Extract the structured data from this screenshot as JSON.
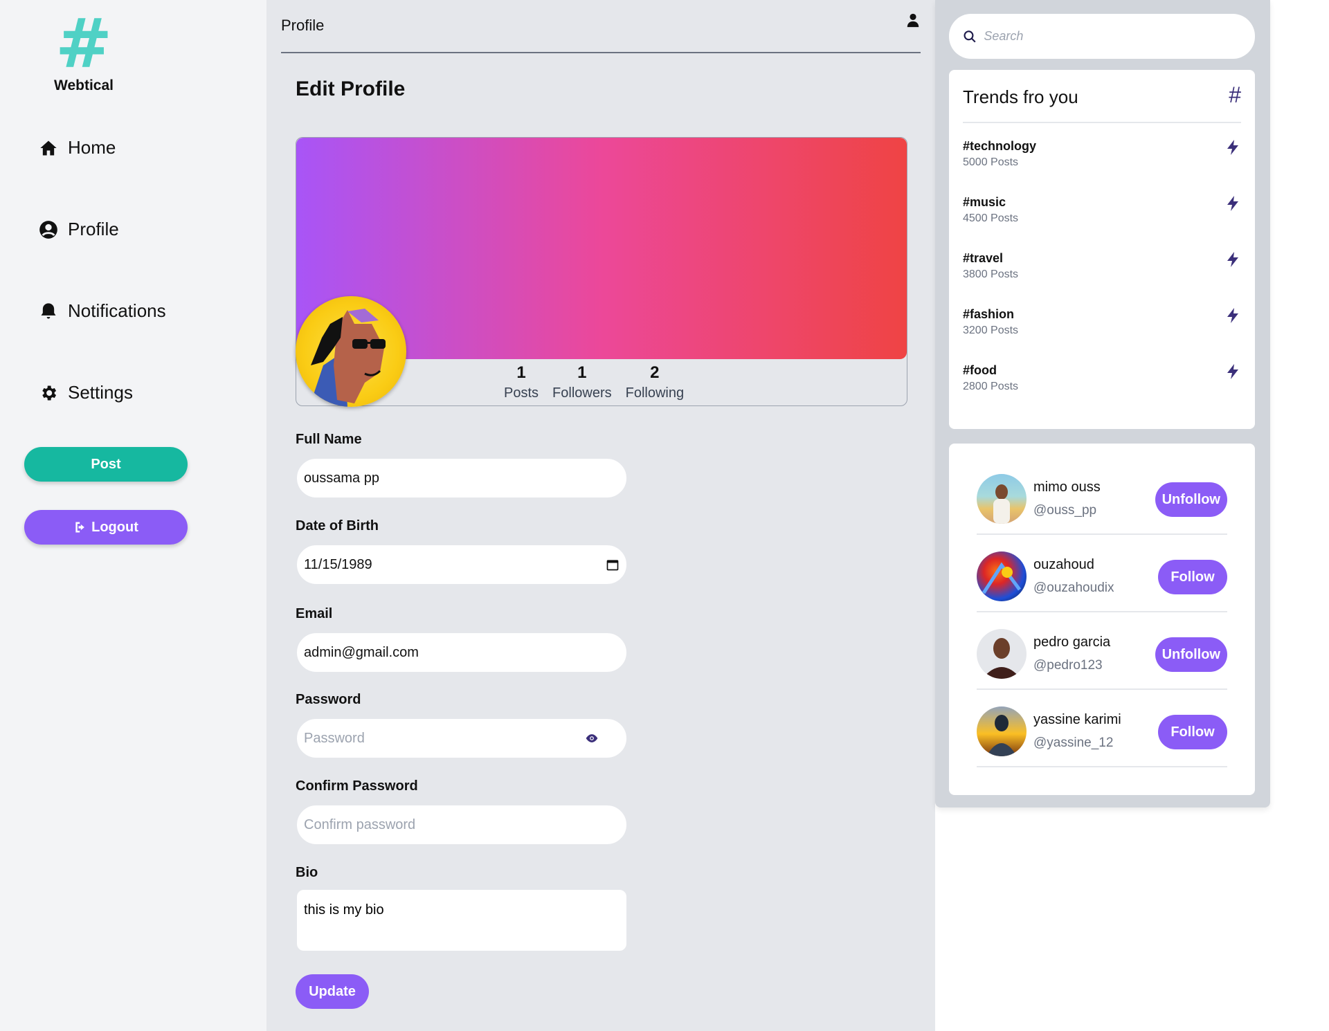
{
  "brand": {
    "name": "Webtical",
    "logo_glyph": "#",
    "accent": "#4fd1c5"
  },
  "nav": {
    "items": [
      {
        "label": "Home",
        "icon": "home-icon"
      },
      {
        "label": "Profile",
        "icon": "user-circle-icon"
      },
      {
        "label": "Notifications",
        "icon": "bell-icon"
      },
      {
        "label": "Settings",
        "icon": "gear-icon"
      }
    ],
    "post_label": "Post",
    "logout_label": "Logout"
  },
  "header": {
    "title": "Profile"
  },
  "page": {
    "heading": "Edit Profile"
  },
  "profile": {
    "stats": [
      {
        "value": "1",
        "label": "Posts"
      },
      {
        "value": "1",
        "label": "Followers"
      },
      {
        "value": "2",
        "label": "Following"
      }
    ]
  },
  "form": {
    "full_name_label": "Full Name",
    "full_name_value": "oussama pp",
    "dob_label": "Date of Birth",
    "dob_value": "11/15/1989",
    "email_label": "Email",
    "email_value": "admin@gmail.com",
    "password_label": "Password",
    "password_placeholder": "Password",
    "confirm_label": "Confirm Password",
    "confirm_placeholder": "Confirm password",
    "bio_label": "Bio",
    "bio_value": "this is my bio",
    "update_label": "Update"
  },
  "search": {
    "placeholder": "Search"
  },
  "trends": {
    "title": "Trends fro you",
    "items": [
      {
        "tag": "#technology",
        "count": "5000 Posts"
      },
      {
        "tag": "#music",
        "count": "4500 Posts"
      },
      {
        "tag": "#travel",
        "count": "3800 Posts"
      },
      {
        "tag": "#fashion",
        "count": "3200 Posts"
      },
      {
        "tag": "#food",
        "count": "2800 Posts"
      }
    ]
  },
  "suggestions": [
    {
      "name": "mimo ouss",
      "handle": "@ouss_pp",
      "action": "Unfollow"
    },
    {
      "name": "ouzahoud",
      "handle": "@ouzahoudix",
      "action": "Follow"
    },
    {
      "name": "pedro garcia",
      "handle": "@pedro123",
      "action": "Unfollow"
    },
    {
      "name": "yassine karimi",
      "handle": "@yassine_12",
      "action": "Follow"
    }
  ],
  "colors": {
    "primary": "#8b5cf6",
    "post_button": "#16b8a0",
    "banner_start": "#a855f7",
    "banner_mid": "#ec4899",
    "banner_end": "#ef4444"
  }
}
